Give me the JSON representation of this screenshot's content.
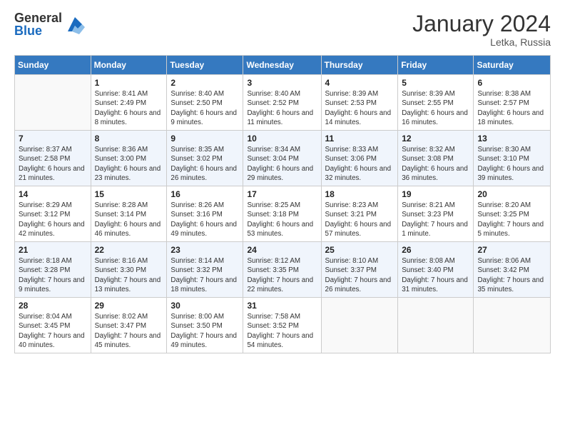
{
  "header": {
    "logo_general": "General",
    "logo_blue": "Blue",
    "month_title": "January 2024",
    "location": "Letka, Russia"
  },
  "days_of_week": [
    "Sunday",
    "Monday",
    "Tuesday",
    "Wednesday",
    "Thursday",
    "Friday",
    "Saturday"
  ],
  "weeks": [
    [
      {
        "num": "",
        "sunrise": "",
        "sunset": "",
        "daylight": ""
      },
      {
        "num": "1",
        "sunrise": "Sunrise: 8:41 AM",
        "sunset": "Sunset: 2:49 PM",
        "daylight": "Daylight: 6 hours and 8 minutes."
      },
      {
        "num": "2",
        "sunrise": "Sunrise: 8:40 AM",
        "sunset": "Sunset: 2:50 PM",
        "daylight": "Daylight: 6 hours and 9 minutes."
      },
      {
        "num": "3",
        "sunrise": "Sunrise: 8:40 AM",
        "sunset": "Sunset: 2:52 PM",
        "daylight": "Daylight: 6 hours and 11 minutes."
      },
      {
        "num": "4",
        "sunrise": "Sunrise: 8:39 AM",
        "sunset": "Sunset: 2:53 PM",
        "daylight": "Daylight: 6 hours and 14 minutes."
      },
      {
        "num": "5",
        "sunrise": "Sunrise: 8:39 AM",
        "sunset": "Sunset: 2:55 PM",
        "daylight": "Daylight: 6 hours and 16 minutes."
      },
      {
        "num": "6",
        "sunrise": "Sunrise: 8:38 AM",
        "sunset": "Sunset: 2:57 PM",
        "daylight": "Daylight: 6 hours and 18 minutes."
      }
    ],
    [
      {
        "num": "7",
        "sunrise": "Sunrise: 8:37 AM",
        "sunset": "Sunset: 2:58 PM",
        "daylight": "Daylight: 6 hours and 21 minutes."
      },
      {
        "num": "8",
        "sunrise": "Sunrise: 8:36 AM",
        "sunset": "Sunset: 3:00 PM",
        "daylight": "Daylight: 6 hours and 23 minutes."
      },
      {
        "num": "9",
        "sunrise": "Sunrise: 8:35 AM",
        "sunset": "Sunset: 3:02 PM",
        "daylight": "Daylight: 6 hours and 26 minutes."
      },
      {
        "num": "10",
        "sunrise": "Sunrise: 8:34 AM",
        "sunset": "Sunset: 3:04 PM",
        "daylight": "Daylight: 6 hours and 29 minutes."
      },
      {
        "num": "11",
        "sunrise": "Sunrise: 8:33 AM",
        "sunset": "Sunset: 3:06 PM",
        "daylight": "Daylight: 6 hours and 32 minutes."
      },
      {
        "num": "12",
        "sunrise": "Sunrise: 8:32 AM",
        "sunset": "Sunset: 3:08 PM",
        "daylight": "Daylight: 6 hours and 36 minutes."
      },
      {
        "num": "13",
        "sunrise": "Sunrise: 8:30 AM",
        "sunset": "Sunset: 3:10 PM",
        "daylight": "Daylight: 6 hours and 39 minutes."
      }
    ],
    [
      {
        "num": "14",
        "sunrise": "Sunrise: 8:29 AM",
        "sunset": "Sunset: 3:12 PM",
        "daylight": "Daylight: 6 hours and 42 minutes."
      },
      {
        "num": "15",
        "sunrise": "Sunrise: 8:28 AM",
        "sunset": "Sunset: 3:14 PM",
        "daylight": "Daylight: 6 hours and 46 minutes."
      },
      {
        "num": "16",
        "sunrise": "Sunrise: 8:26 AM",
        "sunset": "Sunset: 3:16 PM",
        "daylight": "Daylight: 6 hours and 49 minutes."
      },
      {
        "num": "17",
        "sunrise": "Sunrise: 8:25 AM",
        "sunset": "Sunset: 3:18 PM",
        "daylight": "Daylight: 6 hours and 53 minutes."
      },
      {
        "num": "18",
        "sunrise": "Sunrise: 8:23 AM",
        "sunset": "Sunset: 3:21 PM",
        "daylight": "Daylight: 6 hours and 57 minutes."
      },
      {
        "num": "19",
        "sunrise": "Sunrise: 8:21 AM",
        "sunset": "Sunset: 3:23 PM",
        "daylight": "Daylight: 7 hours and 1 minute."
      },
      {
        "num": "20",
        "sunrise": "Sunrise: 8:20 AM",
        "sunset": "Sunset: 3:25 PM",
        "daylight": "Daylight: 7 hours and 5 minutes."
      }
    ],
    [
      {
        "num": "21",
        "sunrise": "Sunrise: 8:18 AM",
        "sunset": "Sunset: 3:28 PM",
        "daylight": "Daylight: 7 hours and 9 minutes."
      },
      {
        "num": "22",
        "sunrise": "Sunrise: 8:16 AM",
        "sunset": "Sunset: 3:30 PM",
        "daylight": "Daylight: 7 hours and 13 minutes."
      },
      {
        "num": "23",
        "sunrise": "Sunrise: 8:14 AM",
        "sunset": "Sunset: 3:32 PM",
        "daylight": "Daylight: 7 hours and 18 minutes."
      },
      {
        "num": "24",
        "sunrise": "Sunrise: 8:12 AM",
        "sunset": "Sunset: 3:35 PM",
        "daylight": "Daylight: 7 hours and 22 minutes."
      },
      {
        "num": "25",
        "sunrise": "Sunrise: 8:10 AM",
        "sunset": "Sunset: 3:37 PM",
        "daylight": "Daylight: 7 hours and 26 minutes."
      },
      {
        "num": "26",
        "sunrise": "Sunrise: 8:08 AM",
        "sunset": "Sunset: 3:40 PM",
        "daylight": "Daylight: 7 hours and 31 minutes."
      },
      {
        "num": "27",
        "sunrise": "Sunrise: 8:06 AM",
        "sunset": "Sunset: 3:42 PM",
        "daylight": "Daylight: 7 hours and 35 minutes."
      }
    ],
    [
      {
        "num": "28",
        "sunrise": "Sunrise: 8:04 AM",
        "sunset": "Sunset: 3:45 PM",
        "daylight": "Daylight: 7 hours and 40 minutes."
      },
      {
        "num": "29",
        "sunrise": "Sunrise: 8:02 AM",
        "sunset": "Sunset: 3:47 PM",
        "daylight": "Daylight: 7 hours and 45 minutes."
      },
      {
        "num": "30",
        "sunrise": "Sunrise: 8:00 AM",
        "sunset": "Sunset: 3:50 PM",
        "daylight": "Daylight: 7 hours and 49 minutes."
      },
      {
        "num": "31",
        "sunrise": "Sunrise: 7:58 AM",
        "sunset": "Sunset: 3:52 PM",
        "daylight": "Daylight: 7 hours and 54 minutes."
      },
      {
        "num": "",
        "sunrise": "",
        "sunset": "",
        "daylight": ""
      },
      {
        "num": "",
        "sunrise": "",
        "sunset": "",
        "daylight": ""
      },
      {
        "num": "",
        "sunrise": "",
        "sunset": "",
        "daylight": ""
      }
    ]
  ]
}
